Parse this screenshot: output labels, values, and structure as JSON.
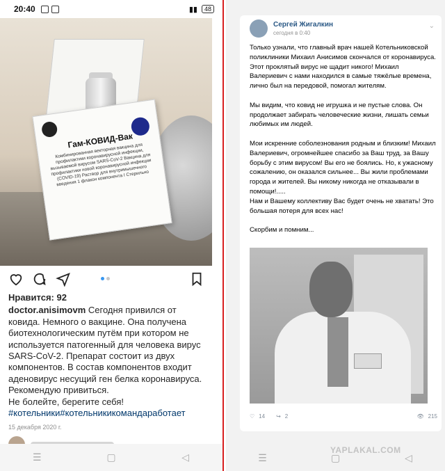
{
  "instagram": {
    "status_time": "20:40",
    "battery": "48",
    "box": {
      "title": "Гам-КОВИД-Вак",
      "text": "Комбинированная векторная вакцина для профилактики коронавирусной инфекции, вызываемой вирусом SARS-CoV-2 Вакцина для профилактики новой коронавирусной инфекции (COVID-19) Раствор для внутримышечного введения 1 флакон компонента I Стерильно"
    },
    "likes": "Нравится: 92",
    "username": "doctor.anisimovm",
    "caption": "Сегодня привился от ковида. Немного о вакцине. Она получена биотехнологическим путём при котором не используется патогенный для человека вирус SARS-CoV-2. Препарат состоит из двух компонентов. В состав компонентов входит аденовирус несущий ген белка коронавируса. Рекомендую привиться.",
    "caption_end": "Не болейте, берегите себя!",
    "hashtags": "#котельники#котельникикомандаработает",
    "date": "15 декабря 2020 г."
  },
  "vk": {
    "author": "Сергей Жигалкин",
    "time": "сегодня в 0:40",
    "paragraphs": [
      "Только узнали, что главный врач нашей Котельниковской поликлиники Михаил Анисимов скончался от коронавируса. Этот проклятый вирус не щадит никого! Михаил Валериевич с нами находился в самые тяжёлые времена, лично был на передовой, помогал жителям.",
      "Мы видим, что ковид не игрушка и не пустые слова. Он продолжает забирать человеческие жизни, лишать семьи любимых им людей.",
      "Мои искренние соболезнования родным и близким! Михаил Валериевич, огромнейшее спасибо за Ваш труд, за Вашу борьбу с этим вирусом! Вы его не боялись. Но, к ужасному сожалению, он оказался сильнее... Вы жили проблемами города и жителей. Вы никому никогда не отказывали в помощи!.....",
      "Нам и Вашему коллективу Вас будет очень не хватать! Это большая потеря для всех нас!",
      "Скорбим и помним..."
    ],
    "likes": "14",
    "shares": "2",
    "views": "215"
  },
  "watermark": "YAPLAKAL.COM",
  "colors": {
    "divider": "#d81e1e",
    "vk_link": "#2a5885",
    "ig_tag": "#00376b"
  },
  "icons": [
    "heart-icon",
    "comment-icon",
    "share-icon",
    "bookmark-icon",
    "like-icon",
    "repost-icon",
    "views-icon"
  ]
}
